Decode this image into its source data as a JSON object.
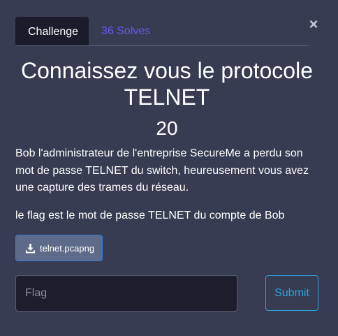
{
  "close": {
    "glyph": "×"
  },
  "tabs": [
    {
      "label": "Challenge"
    },
    {
      "label": "36 Solves"
    }
  ],
  "challenge": {
    "title": "Connaissez vous le protocole TELNET",
    "value": "20",
    "description": "Bob l'administrateur de l'entreprise SecureMe a perdu son mot de passe TELNET du switch, heureusement vous avez une capture des trames du réseau.",
    "hint": "le flag est le mot de passe TELNET du compte de Bob",
    "file": {
      "label": "telnet.pcapng",
      "icon": "download-icon"
    }
  },
  "form": {
    "flag_placeholder": "Flag",
    "flag_value": "",
    "submit_label": "Submit"
  },
  "colors": {
    "accent": "#6f55e8",
    "submit": "#2ba3d6",
    "background": "#373c53"
  }
}
